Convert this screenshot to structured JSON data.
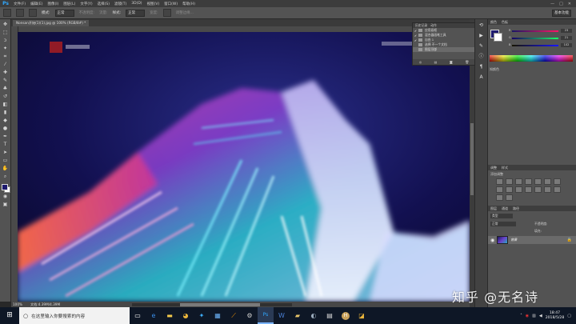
{
  "app": {
    "logo": "Ps"
  },
  "menu": [
    "文件(F)",
    "编辑(E)",
    "图像(I)",
    "图层(L)",
    "文字(Y)",
    "选择(S)",
    "滤镜(T)",
    "3D(D)",
    "视图(V)",
    "窗口(W)",
    "帮助(H)"
  ],
  "window_controls": {
    "min": "—",
    "max": "□",
    "close": "✕"
  },
  "options": {
    "mode_label": "模式:",
    "mode_value": "正常",
    "opacity_label": "不透明度:",
    "flow_label": "流量:",
    "style_label": "样式:",
    "style_value": "正常",
    "width_label": "宽度:",
    "refine_label": "调整边缘...",
    "workspace": "基本功能"
  },
  "document": {
    "tab": "Nonsan开始(1)(1).jpg @ 100% (RGB/8#) *"
  },
  "status": {
    "zoom": "100%",
    "doc": "文档:4.39M/4.39M"
  },
  "history": {
    "tabs": [
      "历史记录",
      "动作"
    ],
    "items": [
      {
        "label": "应用画框",
        "checked": true
      },
      {
        "label": "混合器画笔工具",
        "checked": true
      },
      {
        "label": "自由 1",
        "checked": true
      },
      {
        "label": "选择 不一个文档",
        "checked": false
      },
      {
        "label": "图层顶部",
        "checked": false,
        "selected": true
      }
    ]
  },
  "color_panel": {
    "tabs": [
      "颜色",
      "色板"
    ],
    "channels": [
      {
        "label": "R",
        "value": "23"
      },
      {
        "label": "G",
        "value": "21"
      },
      {
        "label": "B",
        "value": "102"
      }
    ]
  },
  "info_panel": {
    "title": "知颜色"
  },
  "adjust_panel": {
    "tabs": [
      "调整",
      "样式"
    ],
    "title": "添加调整"
  },
  "layers_panel": {
    "tabs": [
      "图层",
      "通道",
      "路径"
    ],
    "kind_label": "类型",
    "blend": "正常",
    "opacity_label": "不透明度:",
    "fill_label": "填充:",
    "layer_name": "背景"
  },
  "taskbar": {
    "search_placeholder": "在这里输入你要搜索的内容",
    "time": "18:47",
    "date": "2018/5/28"
  },
  "watermark": "知乎 @无名诗"
}
